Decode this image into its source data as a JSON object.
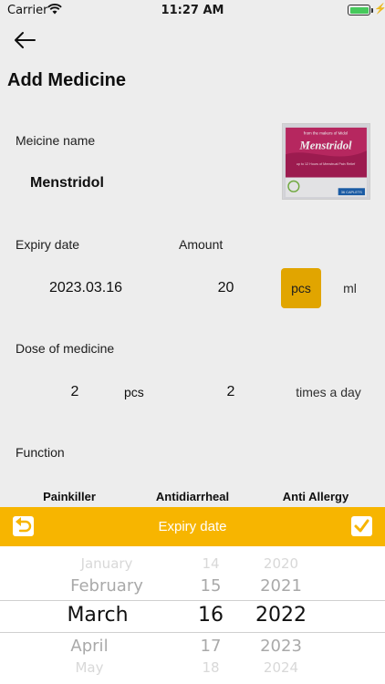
{
  "status_bar": {
    "carrier": "Carrier",
    "time": "11:27 AM"
  },
  "page": {
    "title": "Add Medicine"
  },
  "medicine_name": {
    "label": "Meicine name",
    "value": "Menstridol"
  },
  "medicine_image": {
    "brand_line": "from the makers of Midol",
    "product_name": "Menstridol",
    "tagline": "up to 12 Hours of Menstrual Pain Relief",
    "count": "36 CAPLETS"
  },
  "expiry": {
    "label": "Expiry date",
    "value": "2023.03.16"
  },
  "amount": {
    "label": "Amount",
    "value": "20",
    "units": [
      "pcs",
      "ml"
    ],
    "selected_unit": "pcs"
  },
  "dose": {
    "label": "Dose of medicine",
    "quantity": "2",
    "quantity_unit": "pcs",
    "frequency": "2",
    "frequency_unit": "times a day"
  },
  "function": {
    "label": "Function",
    "options": [
      "Painkiller",
      "Antidiarrheal",
      "Anti Allergy"
    ]
  },
  "picker": {
    "title": "Expiry date",
    "months": [
      "January",
      "February",
      "March",
      "April",
      "May"
    ],
    "days": [
      "14",
      "15",
      "16",
      "17",
      "18"
    ],
    "years": [
      "2020",
      "2021",
      "2022",
      "2023",
      "2024"
    ],
    "selected": {
      "month": "March",
      "day": "16",
      "year": "2022"
    }
  },
  "colors": {
    "accent": "#f7b500",
    "unit_active": "#f3b200",
    "background": "#ffffff"
  }
}
